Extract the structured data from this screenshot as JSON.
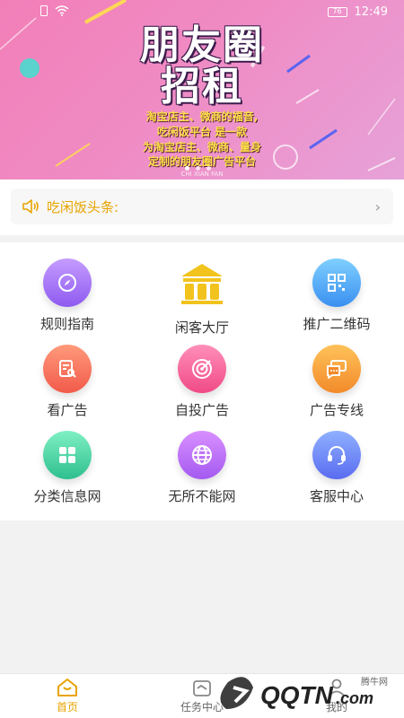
{
  "status_bar": {
    "time": "12:49",
    "battery": "76"
  },
  "banner": {
    "title_line1": "朋友圈",
    "title_line2": "招租",
    "slogan": [
      "淘宝店主、微商的福音,",
      "吃闲饭平台 是一款",
      "为淘宝店主、微商、量身",
      "定制的朋友圈广告平台"
    ],
    "subtitle": "CHI XIAN FAN",
    "slide_count": 3,
    "active_slide": 0
  },
  "headline": {
    "label": "吃闲饭头条:"
  },
  "grid": [
    {
      "label": "规则指南",
      "icon": "compass-icon",
      "color": "#8e5af0"
    },
    {
      "label": "闲客大厅",
      "icon": "hall-icon",
      "color": "#f2c31c"
    },
    {
      "label": "推广二维码",
      "icon": "qrcode-icon",
      "color": "#3a8ff0"
    },
    {
      "label": "看广告",
      "icon": "document-search-icon",
      "color": "#f25a4a"
    },
    {
      "label": "自投广告",
      "icon": "target-icon",
      "color": "#f04a86"
    },
    {
      "label": "广告专线",
      "icon": "chat-icon",
      "color": "#f28a2a"
    },
    {
      "label": "分类信息网",
      "icon": "grid-icon",
      "color": "#2fbf8f"
    },
    {
      "label": "无所不能网",
      "icon": "globe-icon",
      "color": "#a45af0"
    },
    {
      "label": "客服中心",
      "icon": "headset-icon",
      "color": "#5a6cf0"
    }
  ],
  "tabs": [
    {
      "label": "首页",
      "icon": "home-icon",
      "active": true
    },
    {
      "label": "任务中心",
      "icon": "task-icon",
      "active": false
    },
    {
      "label": "我的",
      "icon": "user-icon",
      "active": false
    }
  ],
  "watermark": {
    "brand": "腾牛网",
    "logo_text": "QQTN.com"
  },
  "colors": {
    "accent": "#e8a400",
    "banner": "#f27fb8"
  }
}
